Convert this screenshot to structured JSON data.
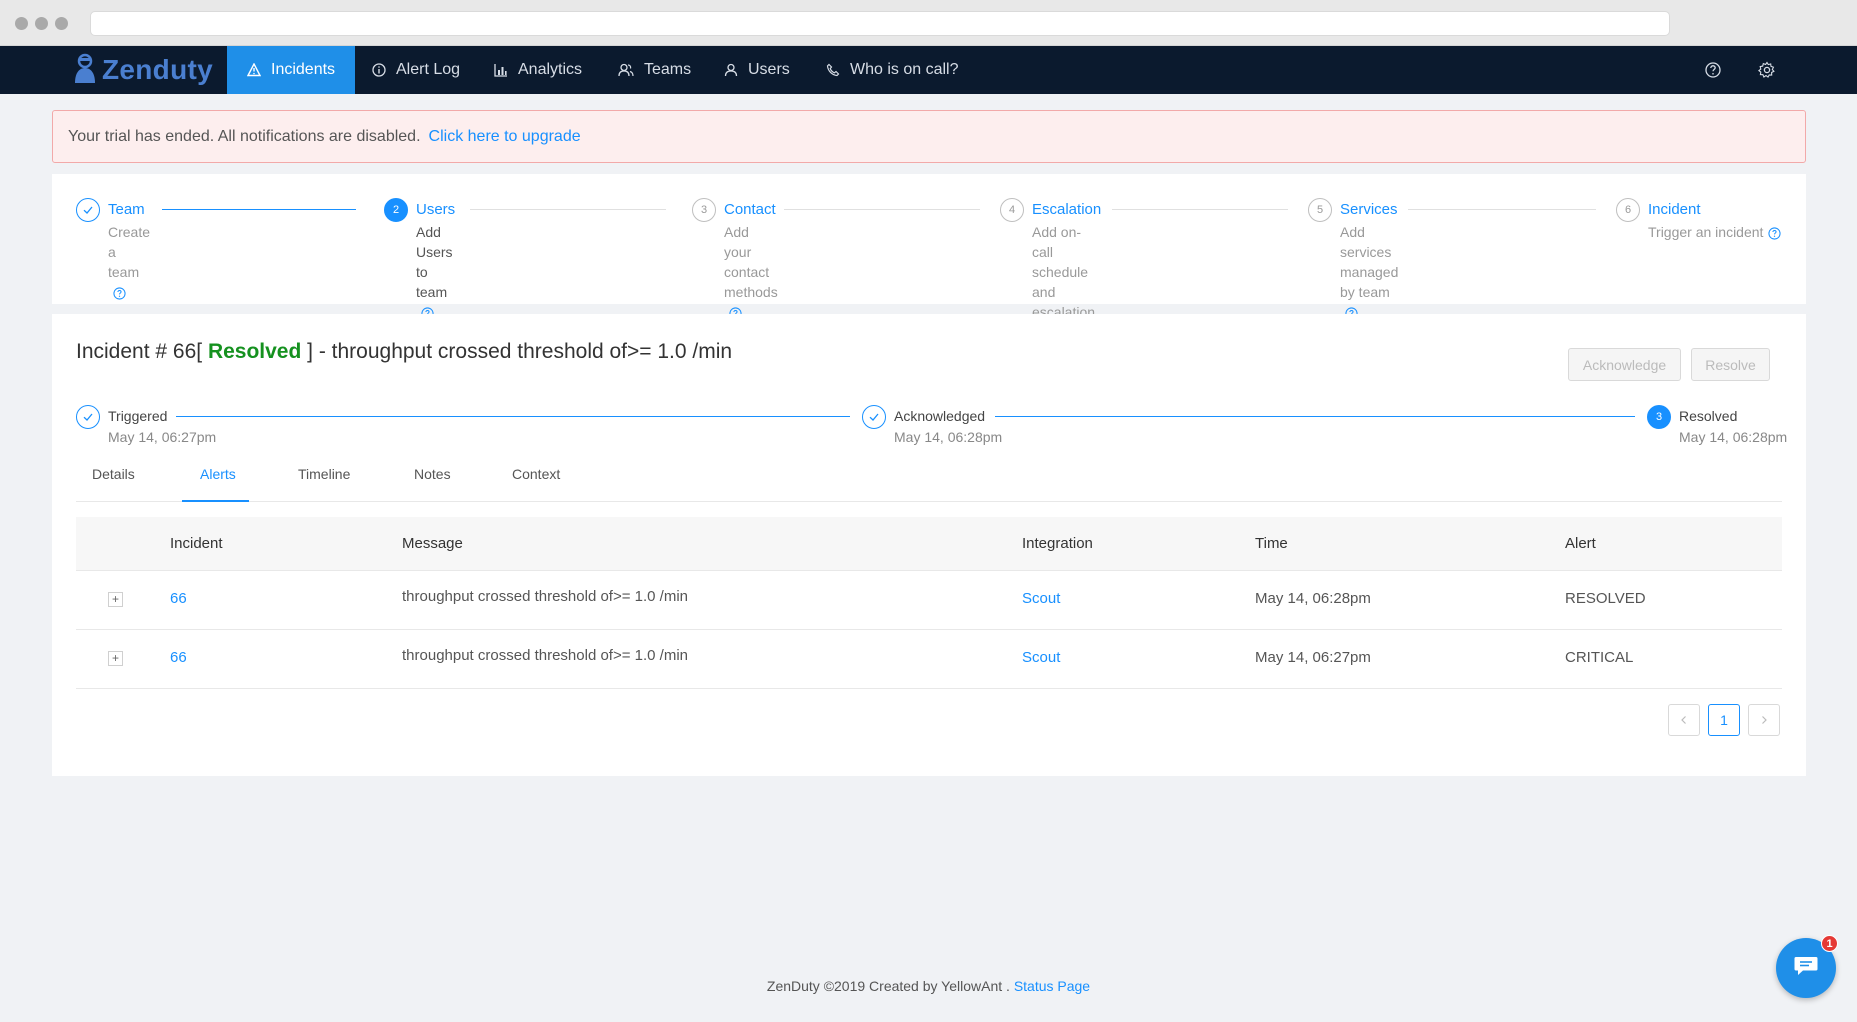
{
  "nav": {
    "brand": "Zenduty",
    "items": [
      {
        "label": "Incidents",
        "icon": "warning-icon"
      },
      {
        "label": "Alert Log",
        "icon": "info-icon"
      },
      {
        "label": "Analytics",
        "icon": "bar-chart-icon"
      },
      {
        "label": "Teams",
        "icon": "team-icon"
      },
      {
        "label": "Users",
        "icon": "user-icon"
      },
      {
        "label": "Who is on call?",
        "icon": "phone-icon"
      }
    ],
    "active_color": "#1f8fe8"
  },
  "banner": {
    "message": "Your trial has ended. All notifications are disabled.",
    "link": "Click here to upgrade"
  },
  "setup_steps": [
    {
      "number": "1",
      "title": "Team",
      "desc_lines": [
        "Create a team"
      ],
      "state": "done"
    },
    {
      "number": "2",
      "title": "Users",
      "desc_lines": [
        "Add Users to team"
      ],
      "state": "active"
    },
    {
      "number": "3",
      "title": "Contact",
      "desc_lines": [
        "Add your contact",
        "methods"
      ],
      "state": "pending"
    },
    {
      "number": "4",
      "title": "Escalation",
      "desc_lines": [
        "Add on-call schedule",
        "and escalation policies"
      ],
      "state": "pending"
    },
    {
      "number": "5",
      "title": "Services",
      "desc_lines": [
        "Add services managed",
        "by team"
      ],
      "state": "pending"
    },
    {
      "number": "6",
      "title": "Incident",
      "desc_lines": [
        "Trigger an incident"
      ],
      "state": "pending"
    }
  ],
  "incident": {
    "title_prefix": "Incident # 66[",
    "status": "Resolved",
    "title_suffix": "] - throughput crossed threshold of>= 1.0 /min",
    "status_color": "#15911f",
    "buttons": {
      "acknowledge": "Acknowledge",
      "resolve": "Resolve"
    },
    "progress": [
      {
        "title": "Triggered",
        "time": "May 14, 06:27pm",
        "state": "done"
      },
      {
        "title": "Acknowledged",
        "time": "May 14, 06:28pm",
        "state": "done"
      },
      {
        "number": "3",
        "title": "Resolved",
        "time": "May 14, 06:28pm",
        "state": "active"
      }
    ],
    "tabs": [
      "Details",
      "Alerts",
      "Timeline",
      "Notes",
      "Context"
    ],
    "active_tab": "Alerts"
  },
  "alerts_table": {
    "columns": [
      "Incident",
      "Message",
      "Integration",
      "Time",
      "Alert"
    ],
    "rows": [
      {
        "incident": "66",
        "message": "throughput crossed threshold of>= 1.0 /min",
        "integration": "Scout",
        "time": "May 14, 06:28pm",
        "alert": "RESOLVED"
      },
      {
        "incident": "66",
        "message": "throughput crossed threshold of>= 1.0 /min",
        "integration": "Scout",
        "time": "May 14, 06:27pm",
        "alert": "CRITICAL"
      }
    ],
    "pagination": {
      "current": "1"
    }
  },
  "footer": {
    "text": "ZenDuty ©2019 Created by YellowAnt .",
    "link": "Status Page"
  },
  "chat": {
    "badge": "1"
  }
}
